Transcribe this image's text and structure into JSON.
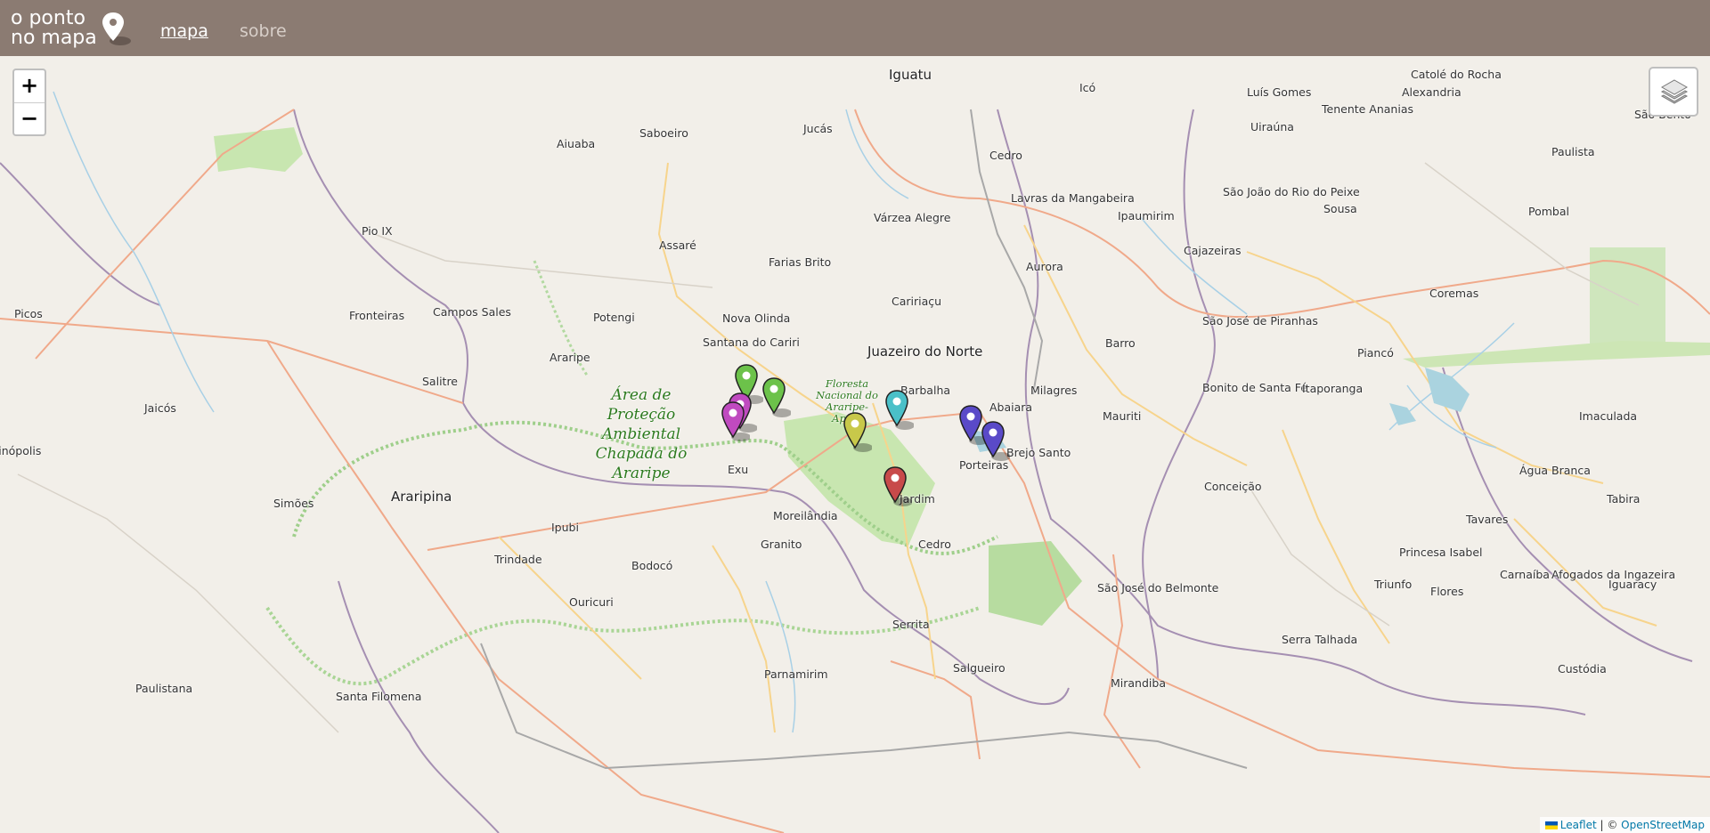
{
  "header": {
    "brand_line1": "o ponto",
    "brand_line2": "no mapa",
    "nav": [
      {
        "label": "mapa",
        "active": true
      },
      {
        "label": "sobre",
        "active": false
      }
    ]
  },
  "map": {
    "zoom_in": "+",
    "zoom_out": "−",
    "layers_icon": "layers-icon",
    "attribution": {
      "leaflet": "Leaflet",
      "separator": " | © ",
      "osm": "OpenStreetMap"
    },
    "places": [
      "Iguatu",
      "Icó",
      "Catolé do Rocha",
      "Luís Gomes",
      "Alexandria",
      "Tenente Ananias",
      "São Bento",
      "Aiuaba",
      "Saboeiro",
      "Jucás",
      "Cedro",
      "Uiraúna",
      "Paulista",
      "Lavras da Mangabeira",
      "Ipaumirim",
      "São João do Rio do Peixe",
      "Sousa",
      "Pombal",
      "Pio IX",
      "Várzea Alegre",
      "Assaré",
      "Farias Brito",
      "Aurora",
      "Cajazeiras",
      "Coremas",
      "Caririaçu",
      "Picos",
      "Fronteiras",
      "Campos Sales",
      "Potengi",
      "Nova Olinda",
      "São José de Piranhas",
      "Santana do Cariri",
      "Juazeiro do Norte",
      "Barro",
      "Piancó",
      "Araripe",
      "Salitre",
      "Barbalha",
      "Milagres",
      "Bonito de Santa Fé",
      "Itaporanga",
      "Jaicós",
      "Abaiara",
      "Mauriti",
      "Imaculada",
      "Brejo Santo",
      "Itainópolis",
      "Exu",
      "Porteiras",
      "Água Branca",
      "Araripina",
      "Conceição",
      "Simões",
      "Jardim",
      "Tabira",
      "Moreilândia",
      "Tavares",
      "Ipubi",
      "Granito",
      "Cedro",
      "Princesa Isabel",
      "Trindade",
      "Bodocó",
      "Triunfo",
      "Carnaíba",
      "Afogados da Ingazeira",
      "Ouricuri",
      "São José do Belmonte",
      "Flores",
      "Iguaracy",
      "Serrita",
      "Serra Talhada",
      "Parnamirim",
      "Salgueiro",
      "Custódia",
      "Paulistana",
      "Santa Filomena",
      "Mirandiba"
    ],
    "protected_areas": [
      "Área de Proteção Ambiental Chapada do Araripe",
      "Floresta Nacional do Araripe-Apodi"
    ],
    "markers": [
      {
        "color": "#6cc24a",
        "icon": "map-pin-icon"
      },
      {
        "color": "#6cc24a",
        "icon": "map-pin-icon"
      },
      {
        "color": "#c04ac0",
        "icon": "map-pin-icon"
      },
      {
        "color": "#c04ac0",
        "icon": "map-pin-icon"
      },
      {
        "color": "#c8c84a",
        "icon": "map-pin-icon"
      },
      {
        "color": "#4ac0c8",
        "icon": "map-pin-icon"
      },
      {
        "color": "#5a4ac8",
        "icon": "map-pin-icon"
      },
      {
        "color": "#5a4ac8",
        "icon": "map-pin-icon"
      },
      {
        "color": "#c84a4a",
        "icon": "map-pin-icon"
      }
    ]
  }
}
